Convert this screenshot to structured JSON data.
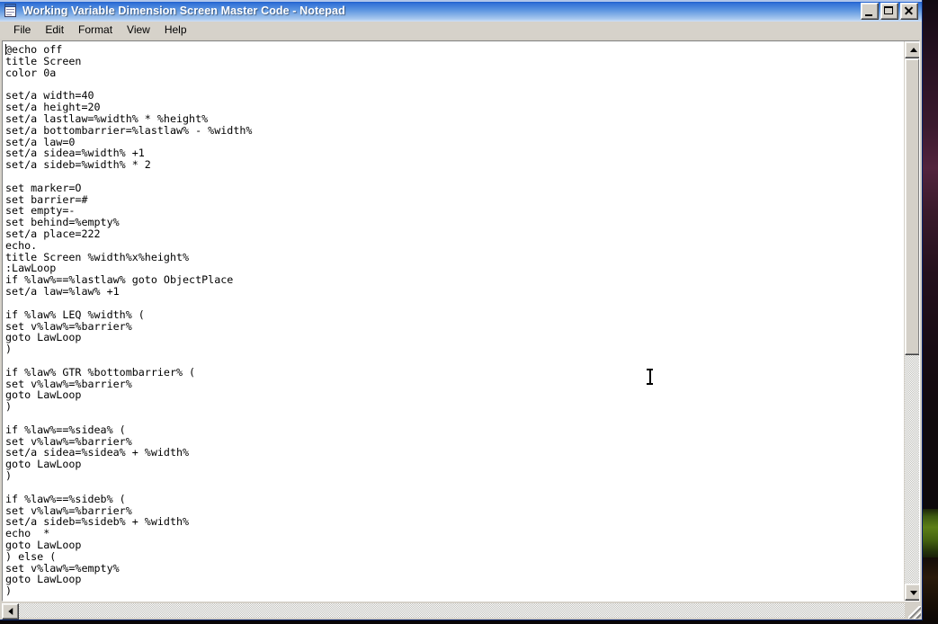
{
  "window": {
    "title": "Working Variable Dimension Screen Master Code - Notepad",
    "app_icon": "notepad-icon",
    "caption_buttons": [
      {
        "name": "minimize",
        "label": "_"
      },
      {
        "name": "maximize",
        "label": "□"
      },
      {
        "name": "close",
        "label": "✕"
      }
    ],
    "colors": {
      "titlebar_active_start": "#0a3ba8",
      "titlebar_active_end": "#cfe0f6",
      "face": "#d4d0c8",
      "text_background": "#ffffff",
      "text_foreground": "#000000"
    }
  },
  "menubar": {
    "items": [
      {
        "name": "file",
        "label": "File"
      },
      {
        "name": "edit",
        "label": "Edit"
      },
      {
        "name": "format",
        "label": "Format"
      },
      {
        "name": "view",
        "label": "View"
      },
      {
        "name": "help",
        "label": "Help"
      }
    ]
  },
  "editor": {
    "content": "@echo off\ntitle Screen\ncolor 0a\n\nset/a width=40\nset/a height=20\nset/a lastlaw=%width% * %height%\nset/a bottombarrier=%lastlaw% - %width%\nset/a law=0\nset/a sidea=%width% +1\nset/a sideb=%width% * 2\n\nset marker=O\nset barrier=#\nset empty=-\nset behind=%empty%\nset/a place=222\necho.\ntitle Screen %width%x%height%\n:LawLoop\nif %law%==%lastlaw% goto ObjectPlace\nset/a law=%law% +1\n\nif %law% LEQ %width% (\nset v%law%=%barrier%\ngoto LawLoop\n)\n\nif %law% GTR %bottombarrier% (\nset v%law%=%barrier%\ngoto LawLoop\n)\n\nif %law%==%sidea% (\nset v%law%=%barrier%\nset/a sidea=%sidea% + %width%\ngoto LawLoop\n)\n\nif %law%==%sideb% (\nset v%law%=%barrier%\nset/a sideb=%sideb% + %width%\necho  *\ngoto LawLoop\n) else (\nset v%law%=%empty%\ngoto LawLoop\n)",
    "caret_line": 1,
    "caret_column": 1
  },
  "scrollbars": {
    "vertical": {
      "up_arrow": "scroll-up-arrow",
      "down_arrow": "scroll-down-arrow",
      "thumb_position_percent": 0,
      "thumb_size_percent": 54
    },
    "horizontal": {
      "left_arrow": "scroll-left-arrow",
      "thumb_position_percent": 0
    }
  },
  "desktop": {
    "wallpaper_description": "dark night landscape"
  }
}
